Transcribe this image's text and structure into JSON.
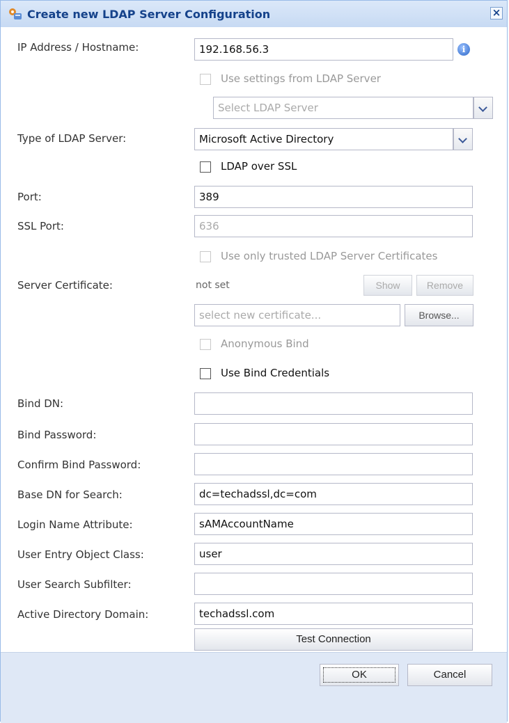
{
  "dialog": {
    "title": "Create new LDAP Server Configuration",
    "close_glyph": "×",
    "accent_color": "#15428b"
  },
  "form": {
    "ip_label": "IP Address / Hostname:",
    "ip_value": "192.168.56.3",
    "info_glyph": "i",
    "use_settings_label": "Use settings from LDAP Server",
    "select_ldap_placeholder": "Select LDAP Server",
    "type_label": "Type of LDAP Server:",
    "type_value": "Microsoft Active Directory",
    "ldap_ssl_label": "LDAP over SSL",
    "port_label": "Port:",
    "port_value": "389",
    "ssl_port_label": "SSL Port:",
    "ssl_port_value": "636",
    "trusted_certs_label": "Use only trusted LDAP Server Certificates",
    "server_cert_label": "Server Certificate:",
    "server_cert_value": "not set",
    "show_button": "Show",
    "remove_button": "Remove",
    "cert_placeholder": "select new certificate...",
    "browse_button": "Browse...",
    "anonymous_bind_label": "Anonymous Bind",
    "use_bind_credentials_label": "Use Bind Credentials",
    "bind_dn_label": "Bind DN:",
    "bind_dn_value": "",
    "bind_password_label": "Bind Password:",
    "bind_password_value": "",
    "confirm_password_label": "Confirm Bind Password:",
    "confirm_password_value": "",
    "base_dn_label": "Base DN for Search:",
    "base_dn_value": "dc=techadssl,dc=com",
    "login_attr_label": "Login Name Attribute:",
    "login_attr_value": "sAMAccountName",
    "user_class_label": "User Entry Object Class:",
    "user_class_value": "user",
    "user_subfilter_label": "User Search Subfilter:",
    "user_subfilter_value": "",
    "ad_domain_label": "Active Directory Domain:",
    "ad_domain_value": "techadssl.com",
    "test_connection_button": "Test Connection"
  },
  "footer": {
    "ok_button": "OK",
    "cancel_button": "Cancel"
  },
  "icons": {
    "title": "ldap-config-icon",
    "info": "info-icon",
    "dropdown": "chevron-down-icon",
    "close": "close-icon"
  }
}
